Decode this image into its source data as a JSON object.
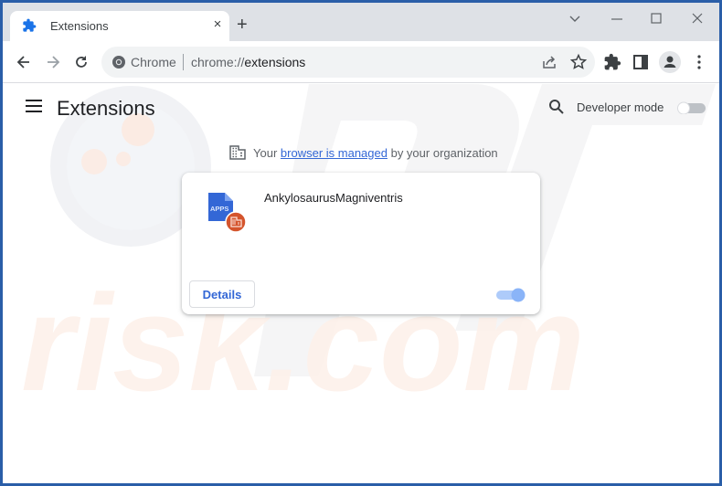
{
  "browser": {
    "tab": {
      "title": "Extensions",
      "icon": "puzzle-icon",
      "close": "×"
    },
    "new_tab": "+",
    "window_controls": [
      "tab-search",
      "minimize",
      "maximize",
      "close"
    ],
    "omnibox": {
      "scheme_label": "Chrome",
      "url_prefix": "chrome://",
      "url_path": "extensions"
    },
    "colors": {
      "frame": "#2a5ea8",
      "tabstrip": "#dee1e6",
      "accent": "#1a73e8"
    }
  },
  "page": {
    "title": "Extensions",
    "developer_mode": {
      "label": "Developer mode",
      "enabled": false
    },
    "managed_notice": {
      "prefix": "Your",
      "link": "browser is managed",
      "suffix": "by your organization"
    },
    "extensions": [
      {
        "name": "AnkylosaurusMagniventris",
        "icon_label": "APPS",
        "details_label": "Details",
        "enabled": true
      }
    ]
  },
  "watermark": {
    "text": "risk.com"
  }
}
